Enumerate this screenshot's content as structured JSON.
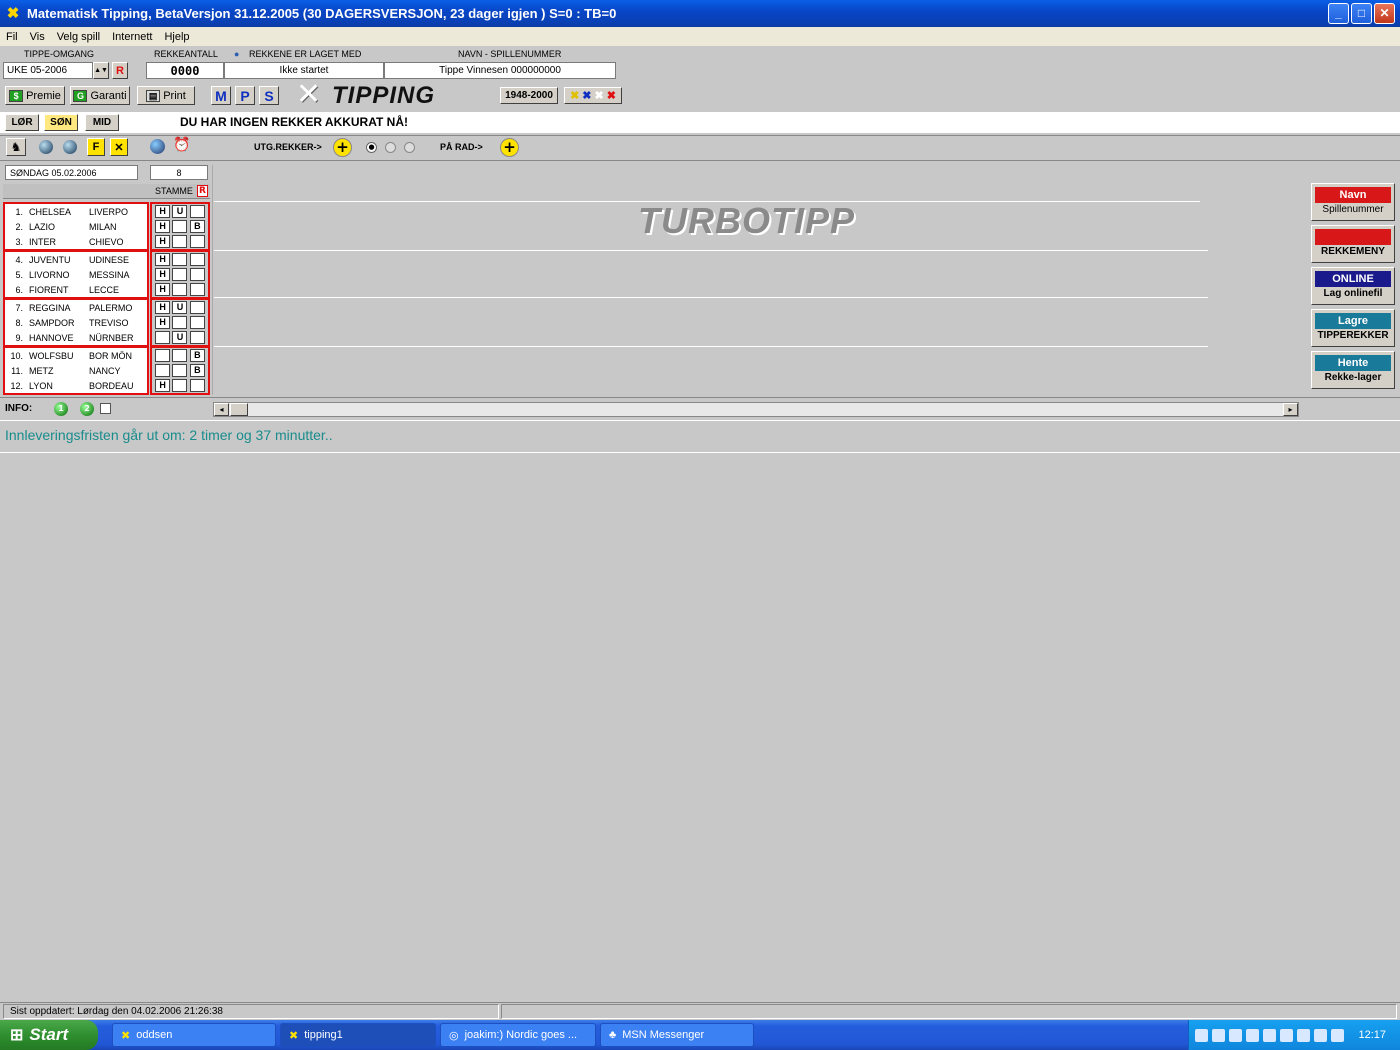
{
  "window": {
    "title": "Matematisk Tipping, BetaVersjon 31.12.2005 (30 DAGERSVERSJON, 23 dager igjen ) S=0 : TB=0",
    "app_icon": "crossed-x-icon",
    "minimize": "_",
    "maximize": "□",
    "close": "✕"
  },
  "menu": [
    "Fil",
    "Vis",
    "Velg spill",
    "Internett",
    "Hjelp"
  ],
  "top": {
    "tippe_omgang_label": "TIPPE-OMGANG",
    "tippe_omgang_value": "UKE 05-2006",
    "rekkeantall_label": "REKKEANTALL",
    "rekkeantall_value": "0000",
    "laget_label": "REKKENE ER LAGET MED",
    "laget_value": "Ikke startet",
    "navn_label": "NAVN  -  SPILLENUMMER",
    "navn_value": "Tippe Vinnesen 000000000",
    "r_button": "R"
  },
  "toolbar": {
    "premie": "Premie",
    "garanti": "Garanti",
    "print": "Print",
    "m": "M",
    "p": "P",
    "s": "S",
    "logo": "TIPPING",
    "year_range": "1948-2000"
  },
  "days": {
    "lor": "LØR",
    "son": "SØN",
    "mid": "MID",
    "message": "DU HAR INGEN REKKER AKKURAT NÅ!"
  },
  "options": {
    "utg_label": "UTG.REKKER->",
    "pa_rad_label": "PÅ RAD->",
    "f_button": "F",
    "x_button": "✕"
  },
  "coupon": {
    "date": "SØNDAG 05.02.2006",
    "count": "8",
    "stamme_label": "STAMME",
    "stamme_r": "R",
    "matches": [
      {
        "num": "1.",
        "home": "CHELSEA",
        "away": "LIVERPO",
        "h": "H",
        "u": "U",
        "b": ""
      },
      {
        "num": "2.",
        "home": "LAZIO",
        "away": "MILAN",
        "h": "H",
        "u": "",
        "b": "B"
      },
      {
        "num": "3.",
        "home": "INTER",
        "away": "CHIEVO",
        "h": "H",
        "u": "",
        "b": ""
      },
      {
        "num": "4.",
        "home": "JUVENTU",
        "away": "UDINESE",
        "h": "H",
        "u": "",
        "b": ""
      },
      {
        "num": "5.",
        "home": "LIVORNO",
        "away": "MESSINA",
        "h": "H",
        "u": "",
        "b": ""
      },
      {
        "num": "6.",
        "home": "FIORENT",
        "away": "LECCE",
        "h": "H",
        "u": "",
        "b": ""
      },
      {
        "num": "7.",
        "home": "REGGINA",
        "away": "PALERMO",
        "h": "H",
        "u": "U",
        "b": ""
      },
      {
        "num": "8.",
        "home": "SAMPDOR",
        "away": "TREVISO",
        "h": "H",
        "u": "",
        "b": ""
      },
      {
        "num": "9.",
        "home": "HANNOVE",
        "away": "NÜRNBER",
        "h": "",
        "u": "U",
        "b": ""
      },
      {
        "num": "10.",
        "home": "WOLFSBU",
        "away": "BOR MÖN",
        "h": "",
        "u": "",
        "b": "B"
      },
      {
        "num": "11.",
        "home": "METZ",
        "away": "NANCY",
        "h": "",
        "u": "",
        "b": "B"
      },
      {
        "num": "12.",
        "home": "LYON",
        "away": "BORDEAU",
        "h": "H",
        "u": "",
        "b": ""
      }
    ]
  },
  "canvas": {
    "brand": "TURBOTIPP"
  },
  "right_buttons": [
    {
      "top": "Navn",
      "bottom": "Spillenummer",
      "color": "#d81818"
    },
    {
      "top": "",
      "bottom": "REKKEMENY",
      "color": "#d81818"
    },
    {
      "top": "ONLINE",
      "bottom": "Lag onlinefil",
      "color": "#1a1a8c"
    },
    {
      "top": "Lagre",
      "bottom": "TIPPEREKKER",
      "color": "#1a7a9a"
    },
    {
      "top": "Hente",
      "bottom": "Rekke-lager",
      "color": "#1a7a9a"
    }
  ],
  "info": {
    "label": "INFO:",
    "deadline": "Innleveringsfristen går ut om:  2 timer og 37 minutter.."
  },
  "status": {
    "last_updated": "Sist oppdatert: Lørdag den 04.02.2006 21:26:38"
  },
  "taskbar": {
    "start": "Start",
    "tasks": [
      "oddsen",
      "tipping1",
      "joakim:) Nordic goes ...",
      "MSN Messenger"
    ],
    "clock": "12:17"
  },
  "colors": {
    "titlebar": "#0a4fd6",
    "accent_red": "#e01010",
    "info_teal": "#1a8c8c"
  }
}
